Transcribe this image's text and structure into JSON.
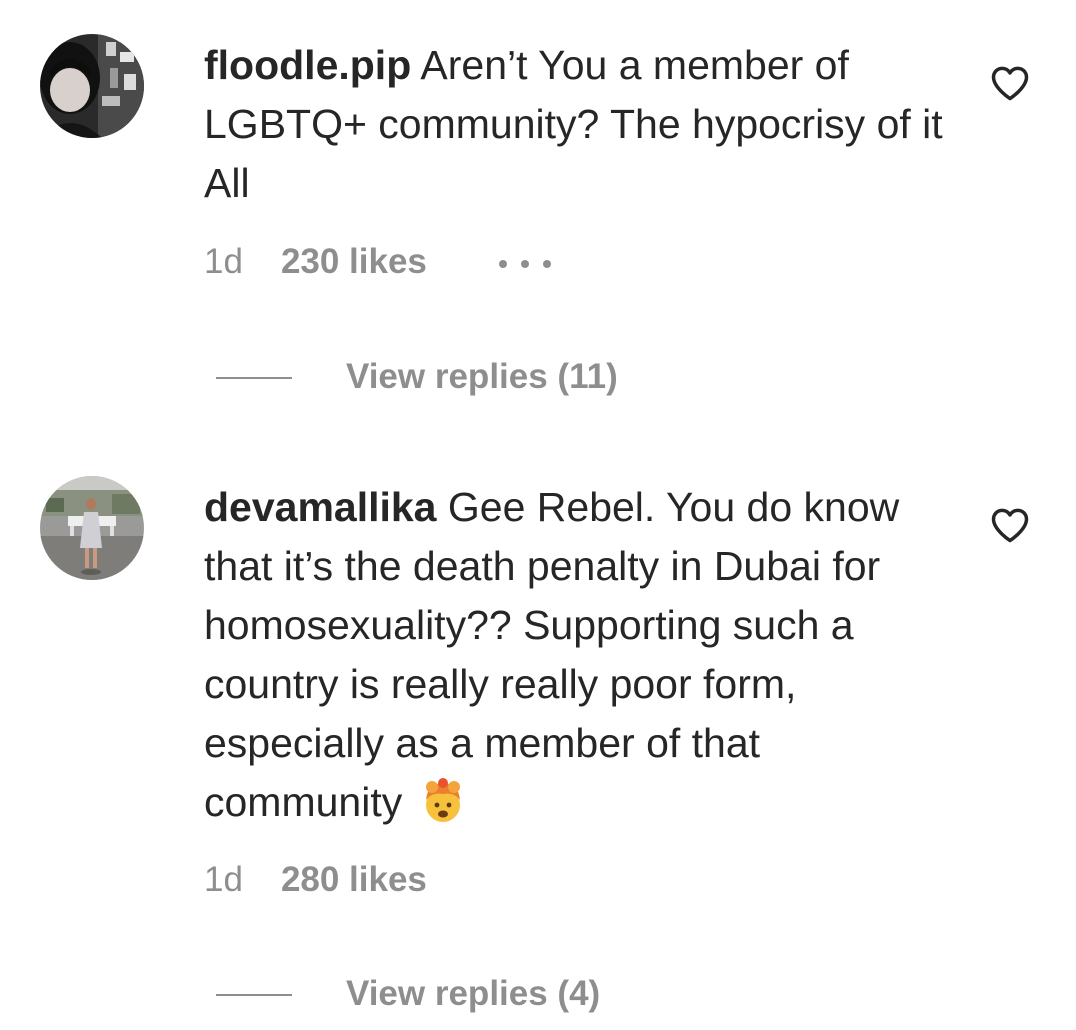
{
  "comments": [
    {
      "username": "floodle.pip",
      "text": "Aren’t You a member of LGBTQ+ community? The hypocrisy of it All",
      "time": "1d",
      "likes": "230 likes",
      "view_replies": "View replies (11)",
      "has_more_menu": true
    },
    {
      "username": "devamallika",
      "text": "Gee Rebel. You do know that it’s the death penalty in Dubai for homosexuality?? Supporting such a country is really really poor form, especially as a member of that community",
      "emoji": "exploding-head-emoji",
      "time": "1d",
      "likes": "280 likes",
      "view_replies": "View replies (4)",
      "has_more_menu": false
    }
  ],
  "colors": {
    "text": "#262626",
    "secondary": "#8e8e8e",
    "background": "#ffffff"
  },
  "icons": [
    "heart-outline-icon",
    "more-options-icon"
  ]
}
